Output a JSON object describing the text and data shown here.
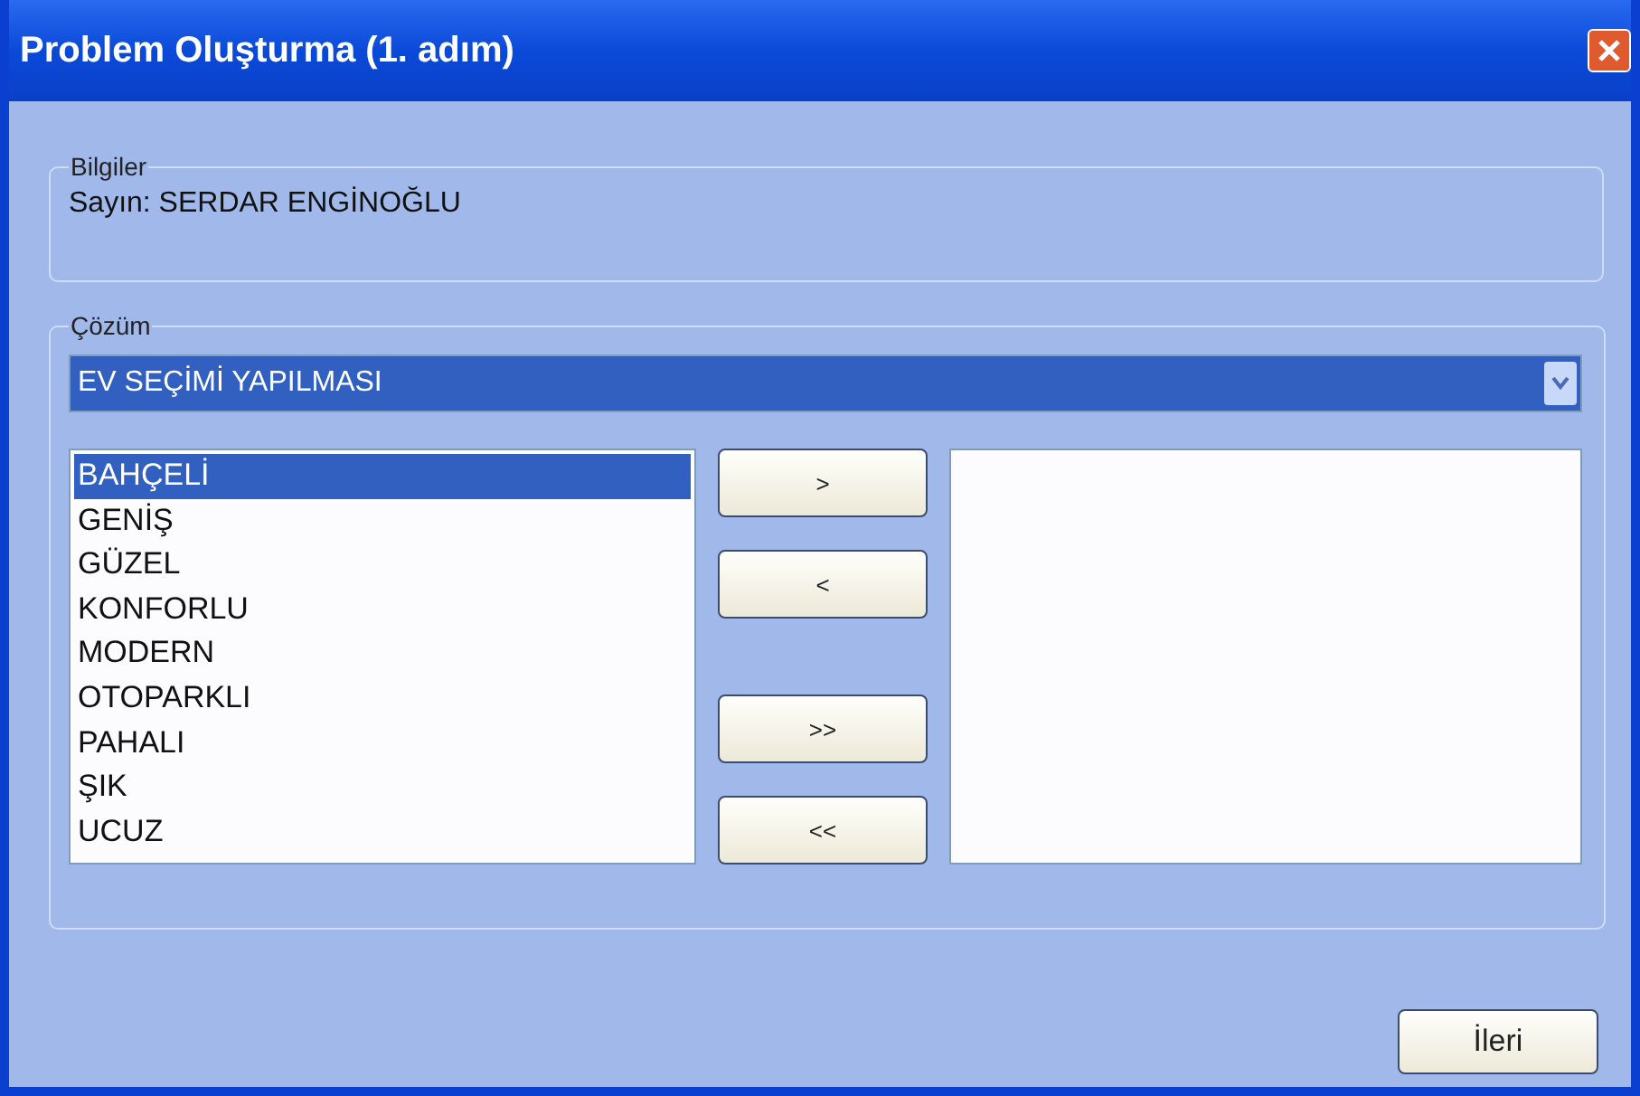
{
  "window": {
    "title": "Problem Oluşturma (1. adım)"
  },
  "info_group": {
    "legend": "Bilgiler",
    "text": "Sayın: SERDAR ENGİNOĞLU"
  },
  "solution_group": {
    "legend": "Çözüm",
    "dropdown": {
      "value": "EV SEÇİMİ YAPILMASI"
    },
    "available_items": [
      {
        "label": "BAHÇELİ",
        "selected": true
      },
      {
        "label": "GENİŞ",
        "selected": false
      },
      {
        "label": "GÜZEL",
        "selected": false
      },
      {
        "label": "KONFORLU",
        "selected": false
      },
      {
        "label": "MODERN",
        "selected": false
      },
      {
        "label": "OTOPARKLI",
        "selected": false
      },
      {
        "label": "PAHALI",
        "selected": false
      },
      {
        "label": "ŞIK",
        "selected": false
      },
      {
        "label": "UCUZ",
        "selected": false
      }
    ],
    "move_buttons": [
      {
        "label": ">"
      },
      {
        "label": "<"
      },
      {
        "label": ">>"
      },
      {
        "label": "<<"
      }
    ]
  },
  "buttons": [
    {
      "label": "İleri"
    }
  ]
}
